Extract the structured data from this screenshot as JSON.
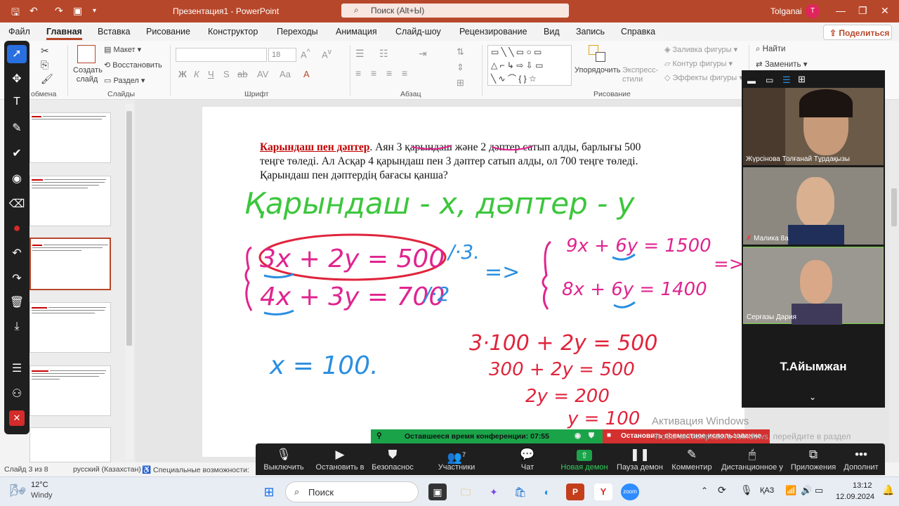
{
  "titlebar": {
    "title": "Презентация1  -  PowerPoint",
    "search": "Поиск (Alt+Ы)",
    "user": "Tolganai",
    "avatar": "T"
  },
  "menu": {
    "items": [
      "Файл",
      "Главная",
      "Вставка",
      "Рисование",
      "Конструктор",
      "Переходы",
      "Анимация",
      "Слайд-шоу",
      "Рецензирование",
      "Вид",
      "Запись",
      "Справка"
    ],
    "share": "Поделиться"
  },
  "ribbon": {
    "clipboard_label": "обмена",
    "new_slide": "Создать слайд",
    "layout": "Макет",
    "reset": "Восстановить",
    "section": "Раздел",
    "slides_label": "Слайды",
    "font_size": "18",
    "font_label": "Шрифт",
    "paragraph_label": "Абзац",
    "arrange": "Упорядочить",
    "quick_styles": "Экспресс-стили",
    "shape_fill": "Заливка фигуры",
    "shape_outline": "Контур фигуры",
    "shape_effects": "Эффекты фигуры",
    "drawing_label": "Рисование",
    "find": "Найти",
    "replace": "Заменить"
  },
  "slide": {
    "title_red": "Карындаш пен дәптер",
    "text_1": ". Аян 3 қарындаш және 2 дәптер сатып алды, барлығы 500 теңге төледі. Ал Асқар 4 қарындаш пен 3 дәптер сатып алды, ол 700 теңге төледі. Қарындаш пен дәптердің бағасы қанша?",
    "hw_green": "Қарындаш - x,   дәптер - y",
    "hw_eq1": "3x + 2y = 500",
    "hw_eq2": "4x + 3y = 700",
    "hw_m1": "/·3.",
    "hw_m2": "/·2",
    "hw_arrow": "=>",
    "hw_eq3": "9x + 6y = 1500",
    "hw_eq4": "8x + 6y = 1400",
    "hw_arrow2": "=>",
    "hw_x": "x = 100.",
    "hw_s1": "3·100 + 2y = 500",
    "hw_s2": "300 + 2y = 500",
    "hw_s3": "2y = 200",
    "hw_s4": "y = 100"
  },
  "video": {
    "p1": "Жүрсінова Толғанай Тұрдақызы",
    "p2": "Малика 8а",
    "p3": "Серғазы Дария",
    "p4": "Т.Айымжан"
  },
  "conference": {
    "time_left": "Оставшееся время конференции: 07:55",
    "stop_share": "Остановить совместное использование"
  },
  "zoom": {
    "mute": "Выключить",
    "stop_video": "Остановить в",
    "security": "Безопаснос",
    "participants": "Участники",
    "participants_count": "7",
    "chat": "Чат",
    "new_share": "Новая демон",
    "pause_share": "Пауза демон",
    "annotate": "Комментир",
    "remote": "Дистанционное у",
    "apps": "Приложения",
    "more": "Дополнит"
  },
  "status": {
    "slide": "Слайд 3 из 8",
    "lang": "русский (Казахстан)",
    "access": "Специальные возможности: пров"
  },
  "watermark": {
    "line1": "Активация Windows",
    "line2": "Чтобы активировать Windows, перейдите в раздел \"Параметры\"."
  },
  "taskbar": {
    "temp": "12°C",
    "weather": "Windy",
    "search": "Поиск",
    "lang": "ҚАЗ",
    "time": "13:12",
    "date": "12.09.2024"
  },
  "colors": {
    "accent": "#b7472a",
    "zoom_green": "#1ba34a",
    "zoom_red": "#d43030"
  }
}
